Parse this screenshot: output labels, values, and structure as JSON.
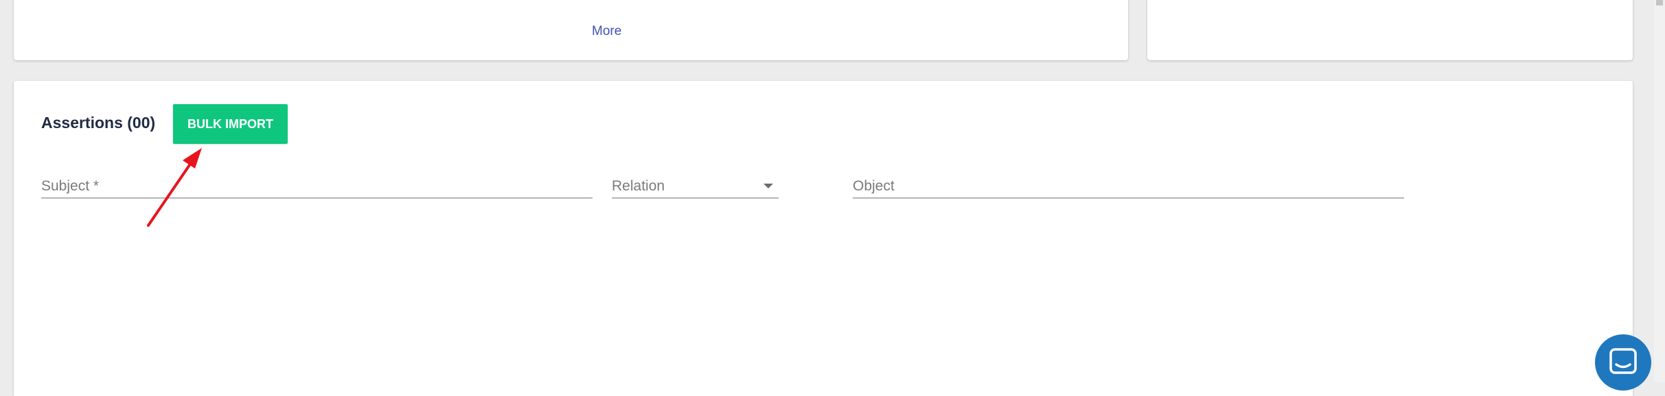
{
  "top_left_card": {
    "more_label": "More"
  },
  "assertions": {
    "heading": "Assertions (00)",
    "bulk_import_label": "BULK IMPORT",
    "subject_placeholder": "Subject *",
    "relation_label": "Relation",
    "object_placeholder": "Object"
  },
  "icons": {
    "relation_dropdown": "caret-down-icon",
    "chat_launcher": "chat-bubble-icon",
    "annotation": "red-arrow-icon"
  },
  "colors": {
    "bulk_import_bg": "#0fc67f",
    "link": "#3f51b5",
    "chat_launcher_bg": "#1f78bd",
    "annotation_arrow": "#e8141c"
  }
}
